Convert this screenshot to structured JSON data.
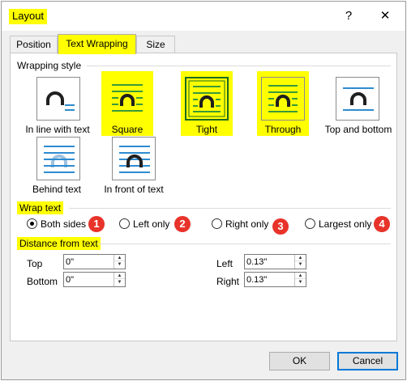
{
  "dialog": {
    "title": "Layout",
    "help_glyph": "?",
    "close_glyph": "✕"
  },
  "tabs": [
    {
      "label": "Position",
      "active": false
    },
    {
      "label": "Text Wrapping",
      "active": true
    },
    {
      "label": "Size",
      "active": false
    }
  ],
  "wrapping_style": {
    "heading": "Wrapping style",
    "options": [
      {
        "label": "In line with text",
        "icon": "inline-with-text-icon",
        "highlighted": false
      },
      {
        "label": "Square",
        "icon": "square-wrap-icon",
        "highlighted": true
      },
      {
        "label": "Tight",
        "icon": "tight-wrap-icon",
        "highlighted": true,
        "selected": true
      },
      {
        "label": "Through",
        "icon": "through-wrap-icon",
        "highlighted": true
      },
      {
        "label": "Top and bottom",
        "icon": "top-and-bottom-icon",
        "highlighted": false
      },
      {
        "label": "Behind text",
        "icon": "behind-text-icon",
        "highlighted": false
      },
      {
        "label": "In front of text",
        "icon": "in-front-of-text-icon",
        "highlighted": false
      }
    ]
  },
  "wrap_text": {
    "heading": "Wrap text",
    "options": [
      {
        "label": "Both sides",
        "checked": true,
        "badge": "1"
      },
      {
        "label": "Left only",
        "checked": false,
        "badge": "2"
      },
      {
        "label": "Right only",
        "checked": false,
        "badge": "3"
      },
      {
        "label": "Largest only",
        "checked": false,
        "badge": "4"
      }
    ]
  },
  "distance": {
    "heading": "Distance from text",
    "top": {
      "label": "Top",
      "value": "0\""
    },
    "bottom": {
      "label": "Bottom",
      "value": "0\""
    },
    "left": {
      "label": "Left",
      "value": "0.13\""
    },
    "right": {
      "label": "Right",
      "value": "0.13\""
    }
  },
  "buttons": {
    "ok": "OK",
    "cancel": "Cancel"
  },
  "colors": {
    "highlight": "#ffff00",
    "icon_line": "#2e8bd0",
    "icon_line_square": "#3a9a3a",
    "badge": "#e8332a",
    "selected_border": "#1e6b1e"
  }
}
